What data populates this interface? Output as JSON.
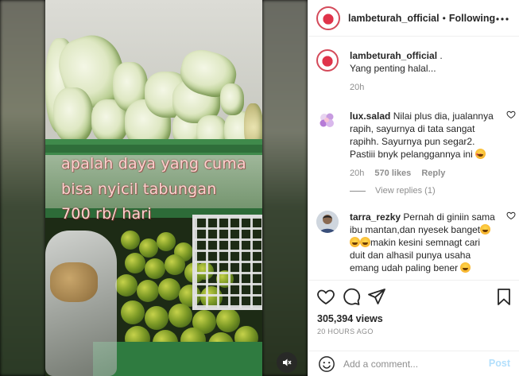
{
  "media": {
    "caption_lines": [
      "apalah daya yang cuma",
      "bisa nyicil tabungan",
      "700 rb/ hari"
    ],
    "mute_icon": "speaker-muted-icon"
  },
  "header": {
    "username": "lambeturah_official",
    "separator": "•",
    "follow_state": "Following",
    "more_icon": "more-horizontal-icon"
  },
  "caption": {
    "username": "lambeturah_official",
    "text_suffix": " .",
    "text_line2": "Yang penting halal...",
    "time": "20h"
  },
  "comments": [
    {
      "username": "lux.salad",
      "text": " Nilai plus dia, jualannya rapih, sayurnya di tata sangat rapihh. Sayurnya pun segar2. Pastiii bnyk pelanggannya ini ",
      "time": "20h",
      "likes": "570 likes",
      "reply": "Reply",
      "view_replies": "View replies (1)"
    },
    {
      "username": "tarra_rezky",
      "text_a": " Pernah di giniin sama ibu mantan,dan nyesek banget",
      "text_b": "makin kesini semnagt cari duit dan alhasil punya usaha emang udah paling bener "
    }
  ],
  "actions": {
    "icons": [
      "heart-icon",
      "comment-icon",
      "share-icon",
      "bookmark-icon"
    ]
  },
  "stats": {
    "views": "305,394 views",
    "ago": "20 HOURS AGO"
  },
  "add_comment": {
    "placeholder": "Add a comment...",
    "post_label": "Post"
  },
  "colors": {
    "accent_disabled": "#b2dffc",
    "muted_text": "#8e8e8e",
    "caption_text": "#ffd0cf",
    "shelf_green": "#3f8a4b"
  }
}
